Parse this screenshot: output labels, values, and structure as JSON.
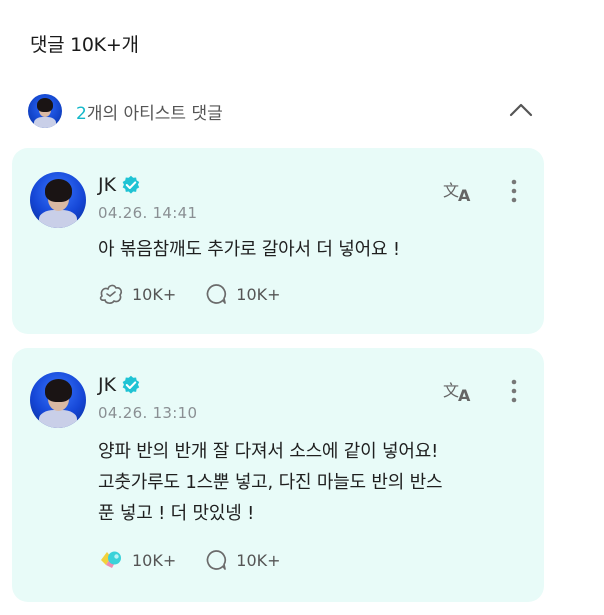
{
  "header": {
    "title": "댓글 10K+개"
  },
  "artist_comments": {
    "count": "2",
    "label": "개의 아티스트 댓글"
  },
  "comments": [
    {
      "author": "JK",
      "timestamp": "04.26. 14:41",
      "text": "아 볶음참깨도 추가로 갈아서 더 넣어요 !",
      "reactions": "10K+",
      "replies": "10K+",
      "reaction_icon": "reaction-outline-icon"
    },
    {
      "author": "JK",
      "timestamp": "04.26. 13:10",
      "text": "양파 반의 반개 잘 다져서 소스에 같이 넣어요!\n고춧가루도 1스뿐 넣고, 다진 마늘도 반의 반스\n푼 넣고 ! 더 맛있넹 !",
      "reactions": "10K+",
      "replies": "10K+",
      "reaction_icon": "reaction-filled-icon"
    }
  ],
  "colors": {
    "card_bg": "#e8fbf8",
    "accent": "#13b8c9",
    "verified": "#1fc3d4"
  }
}
